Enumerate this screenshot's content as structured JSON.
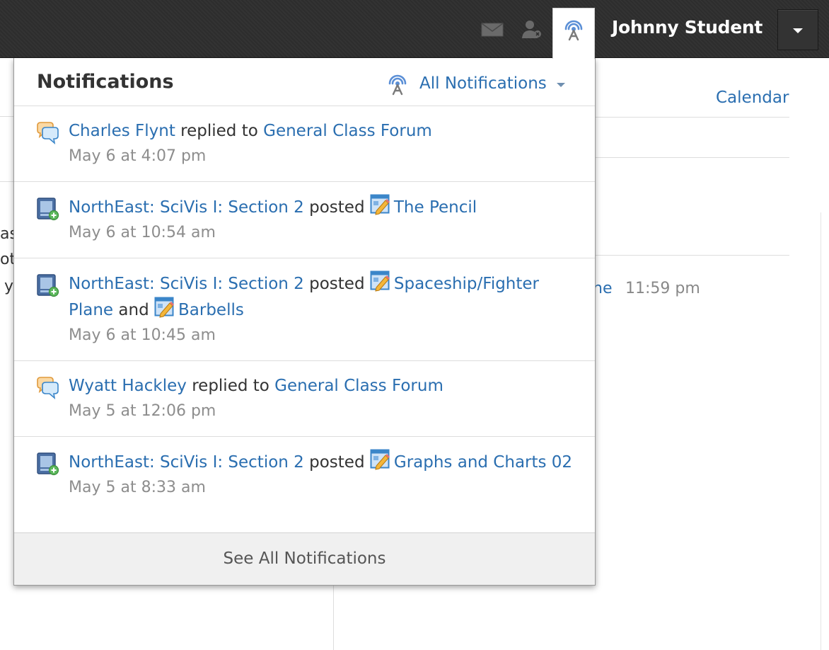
{
  "topbar": {
    "user_name": "Johnny Student",
    "icons": [
      "mail-icon",
      "person-icon",
      "broadcast-icon",
      "chevron-down-icon"
    ]
  },
  "background": {
    "calendar_link": "Calendar",
    "clipped_left_1": "as",
    "clipped_left_2": "ot",
    "clipped_left_3": "y",
    "due_item_fragment": "ne",
    "due_time": "11:59 pm"
  },
  "notifications": {
    "title": "Notifications",
    "filter_label": "All Notifications",
    "see_all_label": "See All Notifications",
    "items": [
      {
        "type": "discussion-reply",
        "icon": "discussion-icon",
        "actor": "Charles Flynt",
        "verb": "replied to",
        "target": "General Class Forum",
        "time": "May 6 at 4:07 pm"
      },
      {
        "type": "post",
        "icon": "new-post-icon",
        "actor": "NorthEast: SciVis I: Section 2",
        "verb": "posted",
        "target": "The Pencil",
        "time": "May 6 at 10:54 am"
      },
      {
        "type": "post",
        "icon": "new-post-icon",
        "actor": "NorthEast: SciVis I: Section 2",
        "verb": "posted",
        "target": "Spaceship/Fighter Plane",
        "conjunction": "and",
        "target2": "Barbells",
        "time": "May 6 at 10:45 am"
      },
      {
        "type": "discussion-reply",
        "icon": "discussion-icon",
        "actor": "Wyatt Hackley",
        "verb": "replied to",
        "target": "General Class Forum",
        "time": "May 5 at 12:06 pm"
      },
      {
        "type": "post",
        "icon": "new-post-icon",
        "actor": "NorthEast: SciVis I: Section 2",
        "verb": "posted",
        "target": "Graphs and Charts 02",
        "time": "May 5 at 8:33 am"
      }
    ]
  },
  "colors": {
    "link": "#2a6eb0",
    "topbar": "#2e2e2e",
    "timestamp": "#8d8d8d"
  }
}
